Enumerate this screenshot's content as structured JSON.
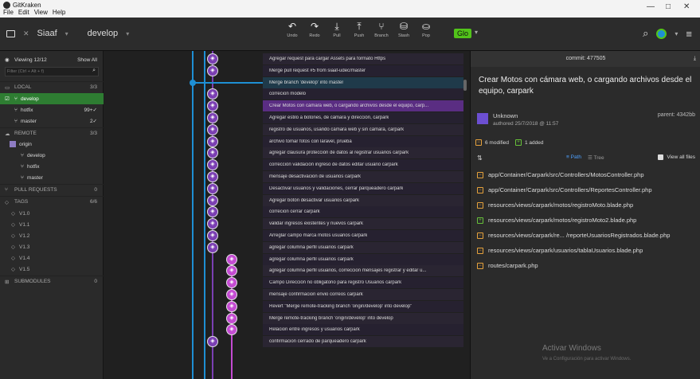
{
  "window": {
    "app_title": "GitKraken",
    "menu": [
      "File",
      "Edit",
      "View",
      "Help"
    ],
    "minimize_label": "—",
    "maximize_label": "□",
    "close_label": "✕"
  },
  "toolbar": {
    "close_tab_label": "✕",
    "repo": "Siaaf",
    "branch": "develop",
    "actions": [
      {
        "icon": "undo-icon",
        "glyph": "↶",
        "label": "Undo"
      },
      {
        "icon": "redo-icon",
        "glyph": "↷",
        "label": "Redo"
      },
      {
        "icon": "pull-icon",
        "glyph": "⤓",
        "label": "Pull"
      },
      {
        "icon": "push-icon",
        "glyph": "⤒",
        "label": "Push"
      },
      {
        "icon": "branch-icon",
        "glyph": "⑂",
        "label": "Branch"
      },
      {
        "icon": "stash-icon",
        "glyph": "⛁",
        "label": "Stash"
      },
      {
        "icon": "pop-icon",
        "glyph": "⛀",
        "label": "Pop"
      }
    ],
    "glo_label": "Glo"
  },
  "sidebar": {
    "viewing": "Viewing 12/12",
    "show_all": "Show All",
    "filter_placeholder": "Filter (Ctrl + Alt + f)",
    "local": {
      "label": "LOCAL",
      "count": "3/3",
      "branches": [
        {
          "name": "develop",
          "status": ""
        },
        {
          "name": "hotfix",
          "status": "99+✓"
        },
        {
          "name": "master",
          "status": "2✓"
        }
      ]
    },
    "remote": {
      "label": "REMOTE",
      "count": "3/3",
      "origin": "origin",
      "branches": [
        "develop",
        "hotfix",
        "master"
      ]
    },
    "pull_requests": {
      "label": "PULL REQUESTS",
      "count": "0"
    },
    "tags": {
      "label": "TAGS",
      "count": "6/6",
      "items": [
        "V1.0",
        "V1.1",
        "V1.2",
        "V1.3",
        "V1.4",
        "V1.5"
      ]
    },
    "submodules": {
      "label": "SUBMODULES",
      "count": "0"
    }
  },
  "commits": [
    "Agregar request para cargar Assets para formato Https",
    "Merge pull request #5 from siaaf-udec/master",
    "Merge branch 'develop' into master",
    "correcion modelo",
    "Crear Motos con cámara web, o cargando archivos desde el equipo, carp...",
    "Agregar estilo a botones, de cámara y dirección, carpark",
    "registro de usuarios, usando cámara web y sin cámara, carpark",
    "archivo tomar fotos con laravel, prueba",
    "agregar clausura protección de datos al registrar usuarios carpark",
    "corrección validación ingreso de datos editar usuario carpark",
    "mensaje desactivacion de usuarios carpark",
    "Desactivar usuarios y validaciones, cerrar parqueadero carpark",
    "Agregar botón desactivar usuarios carpark",
    "correcion cerrar carpark",
    "validar ingresos existentes y nuevos carpark",
    "Arreglar campo marca motos usuarios carpark",
    "agregar columna perfil usuarios carpark",
    "agregar columna perfil usuarios carpark",
    "agregar columna perfil usuarios, correccion mensajes registrar y editar u...",
    "Campo Dirección no obligatorio para registro Usuarios carpark",
    "mensaje confirmacion envio correos carpark",
    "Revert \"Merge remote-tracking branch 'origin/develop' into develop\"",
    "Merge remote-tracking branch 'origin/develop' into develop",
    "Relacion entre ingresos y usuarios carpark",
    "confirmacion cerrado de parqueadero carpark"
  ],
  "detail": {
    "commit_label": "commit: 477505",
    "message": "Crear Motos con cámara web, o cargando archivos desde el equipo, carpark",
    "author": "Unknown",
    "authored": "authored 25/7/2018 @ 11:57",
    "parent": "parent: 4342bb",
    "modified": "6 modified",
    "added": "1 added",
    "path_label": "Path",
    "tree_label": "Tree",
    "view_all": "View all files",
    "files": [
      {
        "path": "app/Container/Carpark/src/Controllers/MotosController.php",
        "status": "modified"
      },
      {
        "path": "app/Container/Carpark/src/Controllers/ReportesController.php",
        "status": "modified"
      },
      {
        "path": "resources/views/carpark/motos/registroMoto.blade.php",
        "status": "modified"
      },
      {
        "path": "resources/views/carpark/motos/registroMoto2.blade.php",
        "status": "added"
      },
      {
        "path": "resources/views/carpark/re... /reporteUsuariosRegistrados.blade.php",
        "status": "modified"
      },
      {
        "path": "resources/views/carpark/usuarios/tablaUsuarios.blade.php",
        "status": "modified"
      },
      {
        "path": "routes/carpark.php",
        "status": "modified"
      }
    ],
    "watermark_title": "Activar Windows",
    "watermark_sub": "Ve a Configuración para activar Windows."
  },
  "colors": {
    "develop": "#7b3fb3",
    "master": "#1e8fd4",
    "hotfix": "#c44bd2",
    "selected": "#5a2d82"
  }
}
